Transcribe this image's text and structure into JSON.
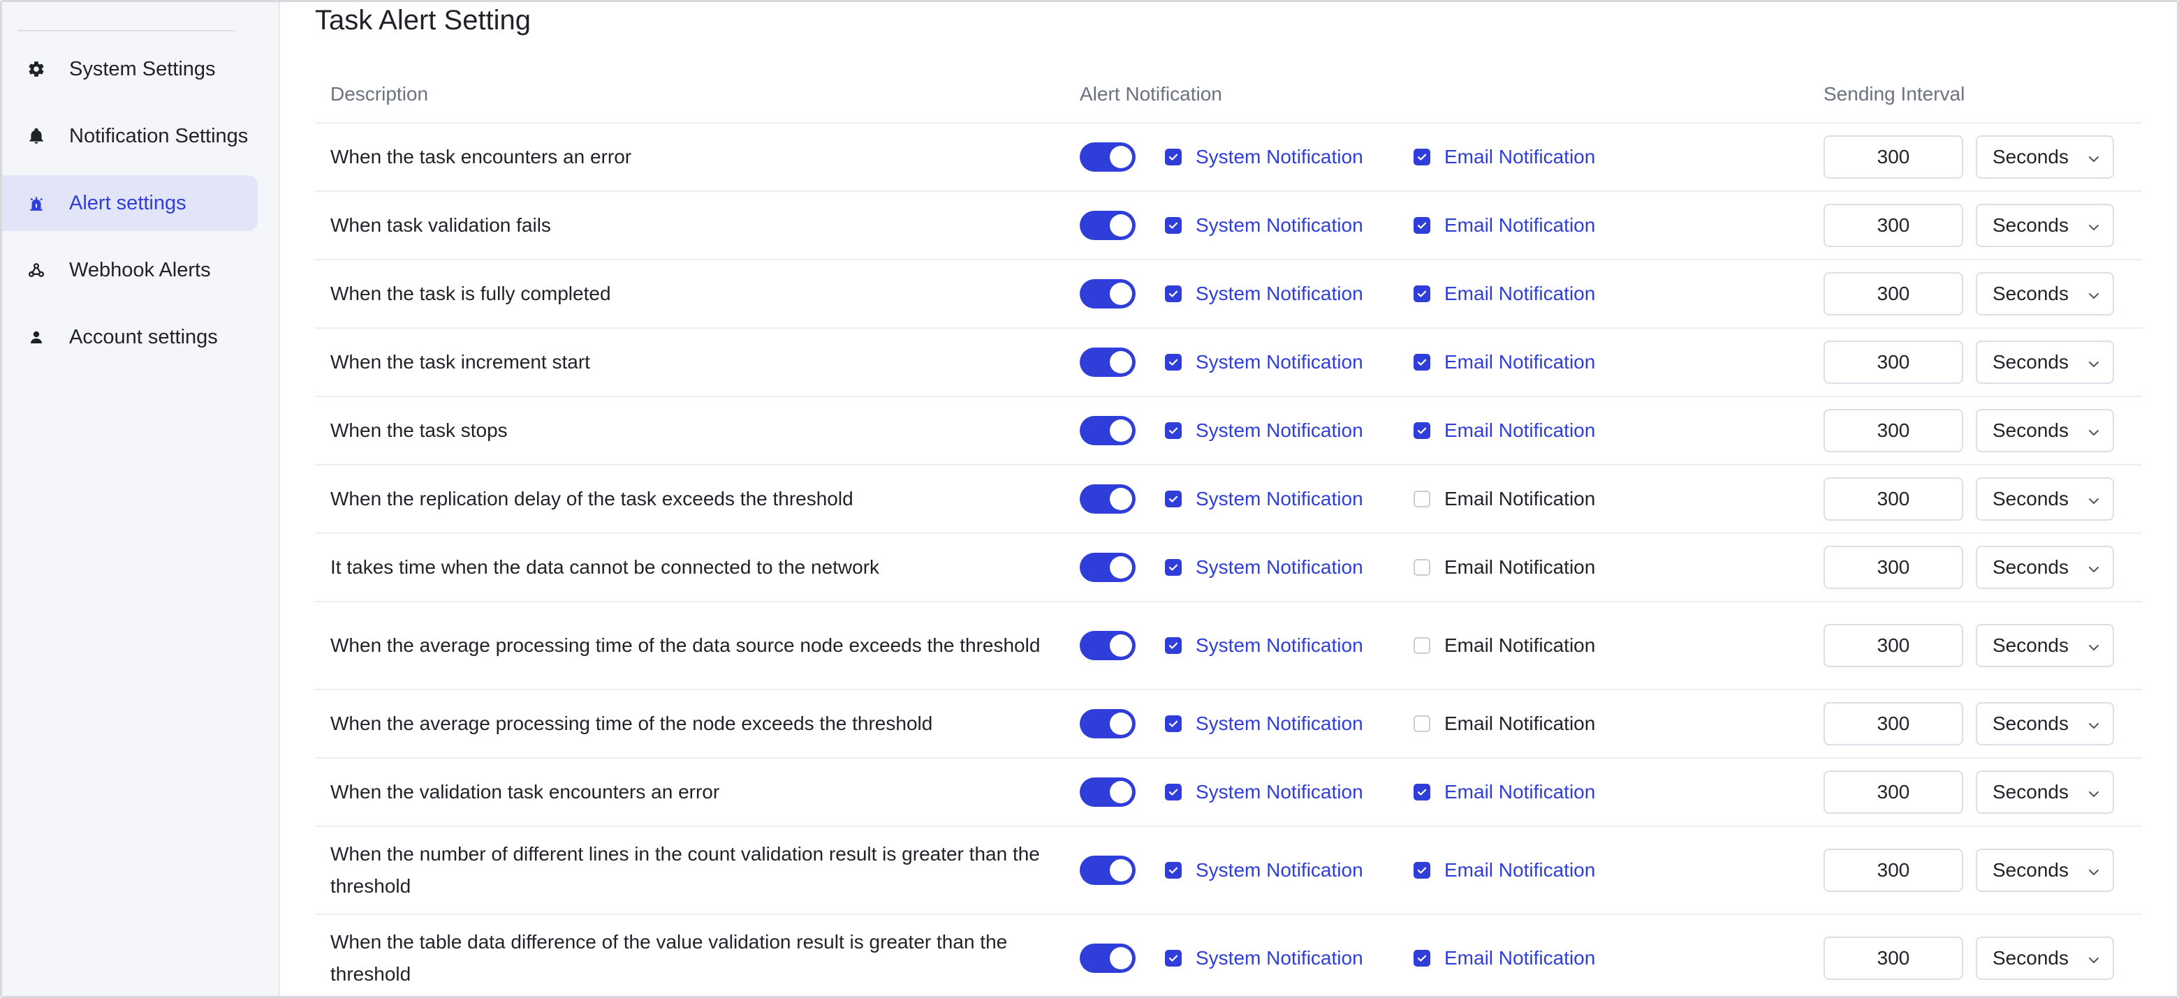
{
  "sidebar": {
    "items": [
      {
        "label": "System Settings",
        "icon": "gear-icon",
        "active": false
      },
      {
        "label": "Notification Settings",
        "icon": "bell-icon",
        "active": false
      },
      {
        "label": "Alert settings",
        "icon": "alarm-icon",
        "active": true
      },
      {
        "label": "Webhook Alerts",
        "icon": "webhook-icon",
        "active": false
      },
      {
        "label": "Account settings",
        "icon": "user-icon",
        "active": false
      }
    ]
  },
  "page": {
    "title": "Task Alert Setting"
  },
  "table": {
    "headers": {
      "description": "Description",
      "alert": "Alert Notification",
      "interval": "Sending Interval"
    },
    "rows": [
      {
        "description": "When the task encounters an error",
        "enabled": true,
        "system": true,
        "email": true,
        "interval": "300",
        "unit": "Seconds"
      },
      {
        "description": "When task validation fails",
        "enabled": true,
        "system": true,
        "email": true,
        "interval": "300",
        "unit": "Seconds"
      },
      {
        "description": "When the task is fully completed",
        "enabled": true,
        "system": true,
        "email": true,
        "interval": "300",
        "unit": "Seconds"
      },
      {
        "description": "When the task increment start",
        "enabled": true,
        "system": true,
        "email": true,
        "interval": "300",
        "unit": "Seconds"
      },
      {
        "description": "When the task stops",
        "enabled": true,
        "system": true,
        "email": true,
        "interval": "300",
        "unit": "Seconds"
      },
      {
        "description": "When the replication delay of the task exceeds the threshold",
        "enabled": true,
        "system": true,
        "email": false,
        "interval": "300",
        "unit": "Seconds"
      },
      {
        "description": "It takes time when the data cannot be connected to the network",
        "enabled": true,
        "system": true,
        "email": false,
        "interval": "300",
        "unit": "Seconds"
      },
      {
        "description": "When the average processing time of the data source node exceeds the threshold",
        "enabled": true,
        "system": true,
        "email": false,
        "interval": "300",
        "unit": "Seconds"
      },
      {
        "description": "When the average processing time of the node exceeds the threshold",
        "enabled": true,
        "system": true,
        "email": false,
        "interval": "300",
        "unit": "Seconds"
      },
      {
        "description": "When the validation task encounters an error",
        "enabled": true,
        "system": true,
        "email": true,
        "interval": "300",
        "unit": "Seconds"
      },
      {
        "description": "When the number of different lines in the count validation result is greater than the threshold",
        "enabled": true,
        "system": true,
        "email": true,
        "interval": "300",
        "unit": "Seconds"
      },
      {
        "description": "When the table data difference of the value validation result is greater than the threshold",
        "enabled": true,
        "system": true,
        "email": true,
        "interval": "300",
        "unit": "Seconds"
      }
    ],
    "labels": {
      "system": "System Notification",
      "email": "Email Notification"
    }
  },
  "colors": {
    "accent": "#2f3ed9",
    "sidebar_bg": "#f4f6fa",
    "active_item_bg": "#e1e5f7"
  }
}
